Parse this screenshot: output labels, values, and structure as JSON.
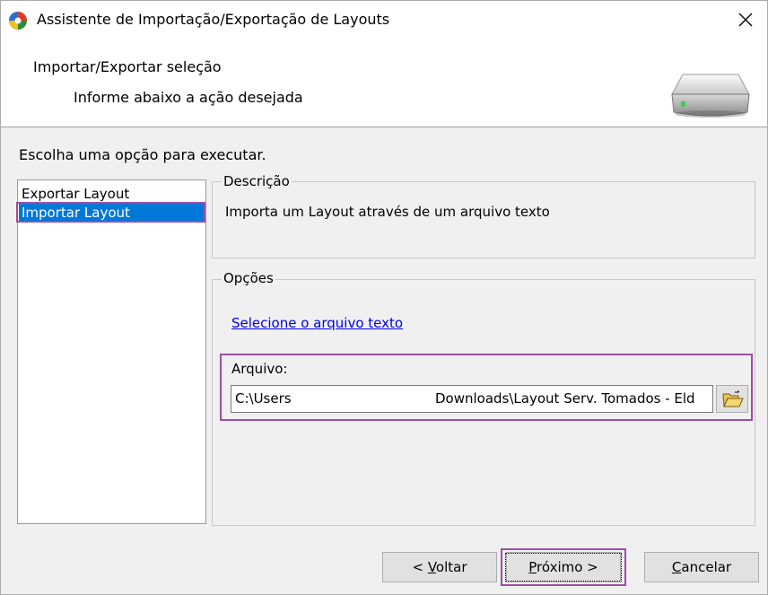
{
  "window": {
    "title": "Assistente de Importação/Exportação de Layouts",
    "icons": {
      "app": "app-globe-icon",
      "close": "close-icon"
    }
  },
  "header": {
    "title": "Importar/Exportar seleção",
    "subtitle": "Informe abaixo a ação desejada",
    "icon": "drive-icon"
  },
  "prompt": "Escolha uma opção para executar.",
  "options": [
    {
      "label": "Exportar Layout",
      "selected": false
    },
    {
      "label": "Importar Layout",
      "selected": true
    }
  ],
  "description": {
    "legend": "Descrição",
    "text": "Importa um Layout através de um arquivo texto"
  },
  "opcoes": {
    "legend": "Opções",
    "link": "Selecione o arquivo texto",
    "file_label": "Arquivo:",
    "file_path_start": "C:\\Users",
    "file_path_end": "Downloads\\Layout Serv. Tomados - Eld",
    "browse_icon": "folder-open-icon"
  },
  "buttons": {
    "back": {
      "pre": "< ",
      "mnemonic": "V",
      "rest": "oltar"
    },
    "next": {
      "mnemonic": "P",
      "rest": "róximo >"
    },
    "cancel": {
      "mnemonic": "C",
      "rest": "ancelar"
    }
  },
  "colors": {
    "selection": "#0078d7",
    "highlight_frame": "#a04ca6",
    "link": "#0000ee"
  }
}
